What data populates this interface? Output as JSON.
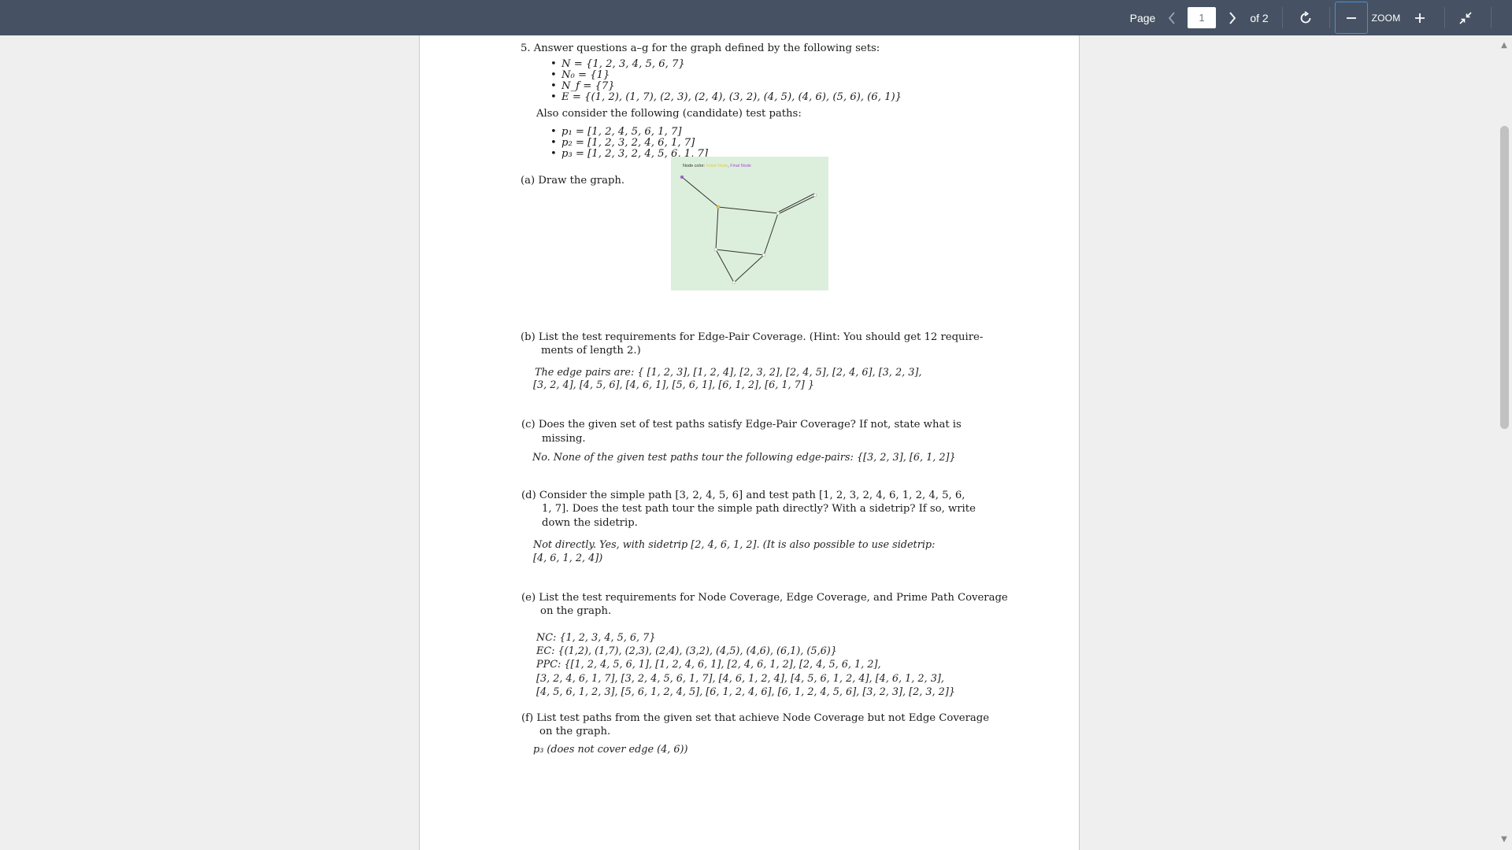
{
  "toolbar": {
    "page_label": "Page",
    "page_value": "1",
    "page_total": "of 2",
    "zoom_label": "ZOOM"
  },
  "doc": {
    "q_intro": "5.  Answer questions a–g for the graph defined by the following sets:",
    "sets": [
      "N = {1, 2, 3, 4, 5, 6, 7}",
      "N₀ = {1}",
      "N_f = {7}",
      "E = {(1, 2), (1, 7), (2, 3), (2, 4), (3, 2), (4, 5), (4, 6), (5, 6), (6, 1)}"
    ],
    "also": "Also consider the following (candidate) test paths:",
    "paths": [
      "p₁ = [1,  2,  4,  5,  6,  1,  7]",
      "p₂ = [1,  2,  3,  2,  4,  6,  1,  7]",
      "p₃ = [1,  2,  3,  2,  4,  5,  6,  1,  7]"
    ],
    "a": "(a)  Draw the graph.",
    "graph_legend_prefix": "Node color:",
    "graph_legend_initial": "Initial Node",
    "graph_legend_sep": ",",
    "graph_legend_final": "Final Node",
    "b_q1": "(b)  List the test requirements for Edge-Pair Coverage.  (Hint:  You should get 12 require-",
    "b_q2": "ments of length 2.)",
    "b_a1": "The edge pairs are:  { [1,  2,  3],  [1,  2,  4],  [2,  3,  2],  [2,  4,  5],  [2,  4,  6],  [3,  2,  3],",
    "b_a2": "[3,  2,  4],  [4,  5,  6],  [4,  6,  1],  [5,  6,  1],  [6,  1,  2],  [6,  1,  7] }",
    "c_q1": "(c)  Does the given set of test paths satisfy Edge-Pair Coverage?   If not, state what is",
    "c_q2": "missing.",
    "c_a": "No.  None of the given test paths tour the following edge-pairs:  {[3,  2,  3], [6,  1,  2]}",
    "d_q1": "(d)  Consider the simple path [3, 2, 4, 5, 6] and test path [1, 2, 3, 2, 4, 6, 1, 2, 4, 5, 6,",
    "d_q2": "1, 7]. Does the test path tour the simple path directly? With a sidetrip? If so, write",
    "d_q3": "down the sidetrip.",
    "d_a1": "Not directly.   Yes, with sidetrip [2,  4,  6,  1,  2].   (It is also possible to use sidetrip:",
    "d_a2": "[4,  6,  1,  2,  4])",
    "e_q1": "(e)  List the test requirements for Node Coverage, Edge Coverage, and Prime Path Coverage",
    "e_q2": "on the graph.",
    "e_nc": "NC:  {1,  2,  3,  4,  5,  6,  7}",
    "e_ec": "EC:  {(1,2),  (1,7),  (2,3),  (2,4),  (3,2),  (4,5),  (4,6),  (6,1),  (5,6)}",
    "e_ppc1": "PPC:  {[1,  2,  4,  5,  6,  1],  [1,  2,  4,  6,  1],  [2,  4,  6,  1,  2],  [2,  4,  5,  6,  1,  2],",
    "e_ppc2": "[3,  2,  4,  6,  1,  7], [3,  2,  4,  5,  6,  1,  7], [4,  6,  1,  2,  4], [4,  5,  6,  1,  2,  4], [4,  6,  1,  2,  3],",
    "e_ppc3": "[4,  5,  6,  1,  2,  3], [5,  6,  1,  2,  4,  5], [6,  1,  2,  4,  6], [6,  1,  2,  4,  5,  6], [3,  2,  3], [2,  3,  2]}",
    "f_q1": "(f)  List test paths from the given set that achieve Node Coverage but not Edge Coverage",
    "f_q2": "on the graph.",
    "f_a": "p₃ (does not cover edge (4,  6))"
  },
  "colors": {
    "toolbar_bg": "#465263",
    "graph_bg": "#dcefdc",
    "initial_node": "#e5c94a",
    "final_node": "#b04ad8",
    "focus_outline": "#4a8fd4"
  }
}
